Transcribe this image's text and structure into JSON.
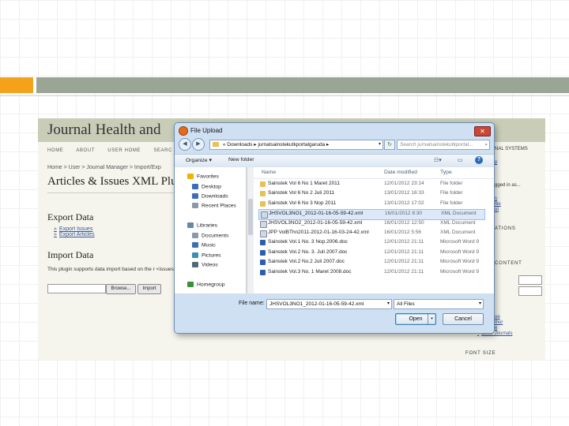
{
  "webpage": {
    "site_title": "Journal Health and",
    "nav": [
      "HOME",
      "ABOUT",
      "USER HOME",
      "SEARC"
    ],
    "breadcrumb": "Home > User > Journal Manager > Import/Exp",
    "page_title": "Articles & Issues XML Plu",
    "export_heading": "Export Data",
    "export_links": [
      "Export Issues",
      "Export Articles"
    ],
    "import_heading": "Import Data",
    "import_desc": "This plugin supports data import based on the r <issues>.",
    "browse_label": "Browse...",
    "import_label": "Import",
    "sidebar": {
      "open_journal_systems": "NAL SYSTEMS",
      "help_link": "p",
      "logged_in": "gged in as...",
      "links": [
        "s",
        "file",
        "ut"
      ],
      "notifications": "ATIONS",
      "content": "CONTENT",
      "search_links": [
        "ue",
        "thor",
        "e"
      ],
      "other_journals": "Other Journals",
      "font_size": "FONT SIZE"
    }
  },
  "dialog": {
    "title": "File Upload",
    "close": "✕",
    "address_path": [
      "«",
      "Downloads",
      "▸",
      "jurnalsainstekutkportalgaruda",
      "▸"
    ],
    "search_placeholder": "Search jurnalsainstekutkportal...",
    "toolbar": {
      "organize": "Organize ▾",
      "new_folder": "New folder",
      "help": "?"
    },
    "nav_pane": [
      {
        "label": "Favorites",
        "icon": "star-icon",
        "color": "#f0b400",
        "indent": false
      },
      {
        "label": "Desktop",
        "icon": "desktop-icon",
        "color": "#3b6fb5",
        "indent": true
      },
      {
        "label": "Downloads",
        "icon": "downloads-icon",
        "color": "#3b6fb5",
        "indent": true
      },
      {
        "label": "Recent Places",
        "icon": "recent-places-icon",
        "color": "#8899aa",
        "indent": true
      },
      {
        "label": "Libraries",
        "icon": "libraries-icon",
        "color": "#6688aa",
        "indent": false
      },
      {
        "label": "Documents",
        "icon": "documents-icon",
        "color": "#8899aa",
        "indent": true
      },
      {
        "label": "Music",
        "icon": "music-icon",
        "color": "#3b6fb5",
        "indent": true
      },
      {
        "label": "Pictures",
        "icon": "pictures-icon",
        "color": "#3b8fb5",
        "indent": true
      },
      {
        "label": "Videos",
        "icon": "videos-icon",
        "color": "#556677",
        "indent": true
      },
      {
        "label": "Homegroup",
        "icon": "homegroup-icon",
        "color": "#3b8f3b",
        "indent": false
      }
    ],
    "columns": {
      "name": "Name",
      "date": "Date modified",
      "type": "Type"
    },
    "files": [
      {
        "name": "Sainstek Vol 6 No 1 Maret 2011",
        "date": "12/01/2012 23:14",
        "type": "File folder",
        "kind": "folder"
      },
      {
        "name": "Sainstek Vol 6 No 2 Juli 2011",
        "date": "13/01/2012 16:33",
        "type": "File folder",
        "kind": "folder"
      },
      {
        "name": "Sainstek Vol 6 No 3 Nop 2011",
        "date": "13/01/2012 17:02",
        "type": "File folder",
        "kind": "folder"
      },
      {
        "name": "JHSVOL3NO1_2012-01-16-05-59-42.xml",
        "date": "16/01/2012 8:30",
        "type": "XML Document",
        "kind": "xml",
        "selected": true
      },
      {
        "name": "JHSVOL3NO2_2012-01-16-05-59-42.xml",
        "date": "16/01/2012 12:50",
        "type": "XML Document",
        "kind": "xml"
      },
      {
        "name": "JPP VolBThn2011-2012-01-16-03-24-42.xml",
        "date": "16/01/2012 5:56",
        "type": "XML Document",
        "kind": "xml"
      },
      {
        "name": "Sainstek Vol.1 No. 3 Nop.2006.doc",
        "date": "12/01/2012 21:11",
        "type": "Microsoft Word 9",
        "kind": "doc"
      },
      {
        "name": "Sainstek Vol.2 No. 3. Juli 2007.doc",
        "date": "12/01/2012 21:11",
        "type": "Microsoft Word 9",
        "kind": "doc"
      },
      {
        "name": "Sainstek Vol.2 No.2 Juli 2007.doc",
        "date": "12/01/2012 21:11",
        "type": "Microsoft Word 9",
        "kind": "doc"
      },
      {
        "name": "Sainstek Vol.3 No. 1 Maret 2008.doc",
        "date": "12/01/2012 21:11",
        "type": "Microsoft Word 9",
        "kind": "doc"
      }
    ],
    "file_name_label": "File name:",
    "file_name_value": "JHSVOL3NO1_2012-01-16-05-59-42.xml",
    "file_type_value": "All Files",
    "open_label": "Open",
    "cancel_label": "Cancel"
  }
}
